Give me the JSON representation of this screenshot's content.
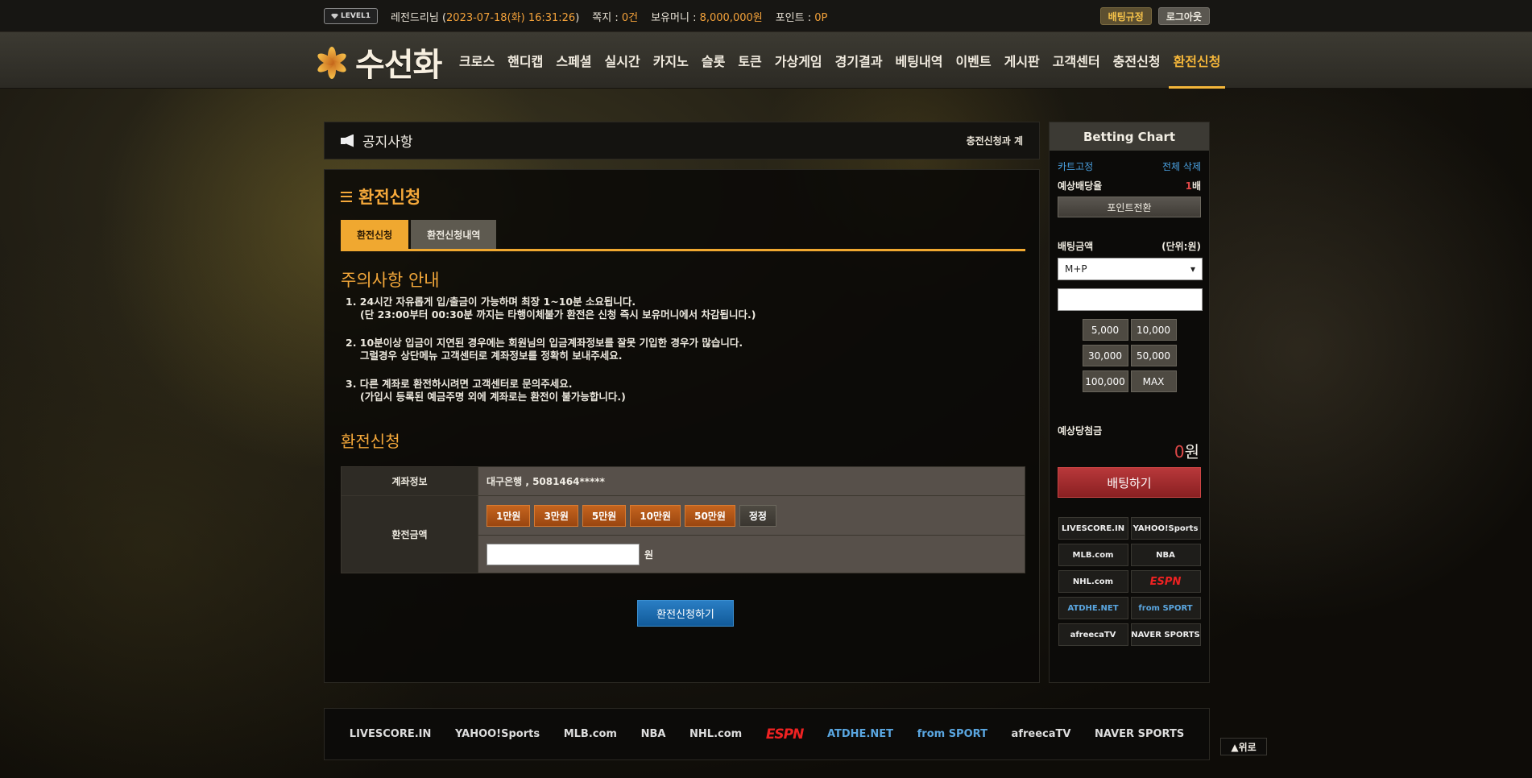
{
  "topbar": {
    "level": "LEVEL1",
    "user": "레전드리님",
    "datetime": "2023-07-18(화) 16:31:26",
    "messages_label": "쪽지 :",
    "messages_count": "0건",
    "money_label": "보유머니 :",
    "money_value": "8,000,000원",
    "points_label": "포인트 :",
    "points_value": "0P",
    "rules_label": "배팅규정",
    "logout_label": "로그아웃"
  },
  "header": {
    "logo_text": "수선화",
    "nav": [
      "크로스",
      "핸디캡",
      "스페셜",
      "실시간",
      "카지노",
      "슬롯",
      "토큰",
      "가상게임",
      "경기결과",
      "베팅내역",
      "이벤트",
      "게시판",
      "고객센터",
      "충전신청",
      "환전신청"
    ],
    "active": "환전신청"
  },
  "notice": {
    "title": "공지사항",
    "scroll_text": "충전신청과 계"
  },
  "main": {
    "title": "환전신청",
    "tabs": [
      "환전신청",
      "환전신청내역"
    ],
    "caution_title": "주의사항 안내",
    "cautions": [
      {
        "line": "1. 24시간 자유롭게 입/출금이 가능하며 최장 1~10분 소요됩니다.",
        "sub": "(단 23:00부터 00:30분 까지는 타행이체불가 환전은 신청 즉시 보유머니에서 차감됩니다.)"
      },
      {
        "line": "2. 10분이상 입금이 지연된 경우에는 회원님의 입금계좌정보를 잘못 기입한 경우가 많습니다.",
        "sub": "그럴경우 상단메뉴 고객센터로 계좌정보를 정확히 보내주세요."
      },
      {
        "line": "3. 다른 계좌로 환전하시려면 고객센터로 문의주세요.",
        "sub": "(가입시 등록된 예금주명 외에 계좌로는 환전이 불가능합니다.)"
      }
    ],
    "form_title": "환전신청",
    "account_label": "계좌정보",
    "account_value": "대구은행 , 5081464*****",
    "amount_label": "환전금액",
    "amount_buttons": [
      "1만원",
      "3만원",
      "5만원",
      "10만원",
      "50만원"
    ],
    "reset_label": "정정",
    "won_unit": "원",
    "submit_label": "환전신청하기"
  },
  "bet": {
    "title": "Betting Chart",
    "fix": "카트고정",
    "delete_all": "전체 삭제",
    "expected_odds_label": "예상배당율",
    "expected_odds_value": "1",
    "expected_odds_unit": "배",
    "point_convert": "포인트전환",
    "amount_label": "배팅금액",
    "unit_label": "(단위:원)",
    "select_value": "M+P",
    "quick": [
      "5,000",
      "10,000",
      "30,000",
      "50,000",
      "100,000",
      "MAX"
    ],
    "win_label": "예상당첨금",
    "win_value": "0",
    "win_unit": "원",
    "go_label": "배팅하기",
    "logos": [
      "LIVESCORE.IN",
      "YAHOO!Sports",
      "MLB.com",
      "NBA",
      "NHL.com",
      "ESPN",
      "ATDHE.NET",
      "from SPORT",
      "afreecaTV",
      "NAVER SPORTS"
    ]
  },
  "footer": {
    "logos": [
      "LIVESCORE.IN",
      "YAHOO!Sports",
      "MLB.com",
      "NBA",
      "NHL.com",
      "ESPN",
      "ATDHE.NET",
      "from SPORT",
      "afreecaTV",
      "NAVER SPORTS"
    ],
    "to_top": "▲위로"
  }
}
